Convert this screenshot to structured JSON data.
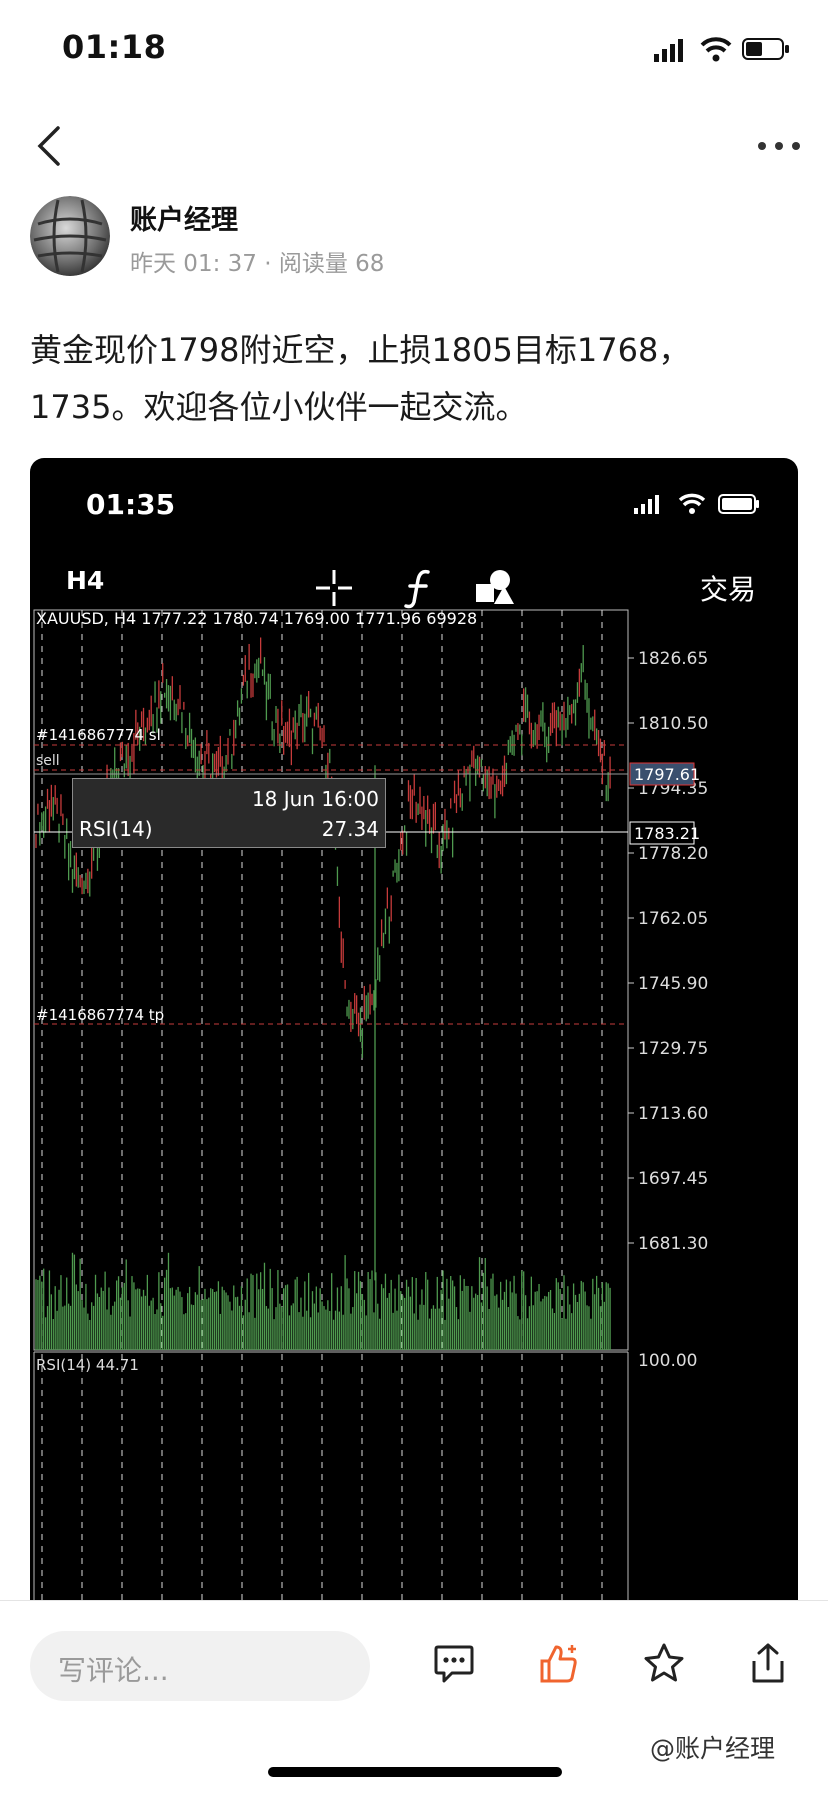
{
  "status": {
    "time": "01:18"
  },
  "post": {
    "author": "账户经理",
    "meta": "昨天 01: 37 · 阅读量 68",
    "body": "黄金现价1798附近空，止损1805目标1768，1735。欢迎各位小伙伴一起交流。"
  },
  "screenshot": {
    "status_time": "01:35",
    "timeframe": "H4",
    "trade_label": "交易",
    "toolbar_icons": [
      "crosshair-icon",
      "function-icon",
      "objects-icon"
    ],
    "ohlc": "XAUUSD, H4  1777.22  1780.74  1769.00  1771.96  69928",
    "sl_label": "#1416867774 sl",
    "tp_label": "#1416867774 tp",
    "sell_label": "sell",
    "price_scale": [
      "1826.65",
      "1810.50",
      "1794.35",
      "1778.20",
      "1762.05",
      "1745.90",
      "1729.75",
      "1713.60",
      "1697.45",
      "1681.30"
    ],
    "bid_badge": "1797.61",
    "cross_badge": "1783.21",
    "rsi_label": "RSI(14)  44.71",
    "rsi_scale": "100.00",
    "tooltip": {
      "date": "18 Jun 16:00",
      "label": "RSI(14)",
      "value": "27.34"
    },
    "colors": {
      "bull": "#4f9a4f",
      "bear": "#c63b3b",
      "line": "#c63b3b"
    }
  },
  "bottom": {
    "comment_placeholder": "写评论...",
    "watermark": "@账户经理",
    "icons": [
      "comment-icon",
      "like-icon",
      "star-icon",
      "share-icon"
    ]
  }
}
